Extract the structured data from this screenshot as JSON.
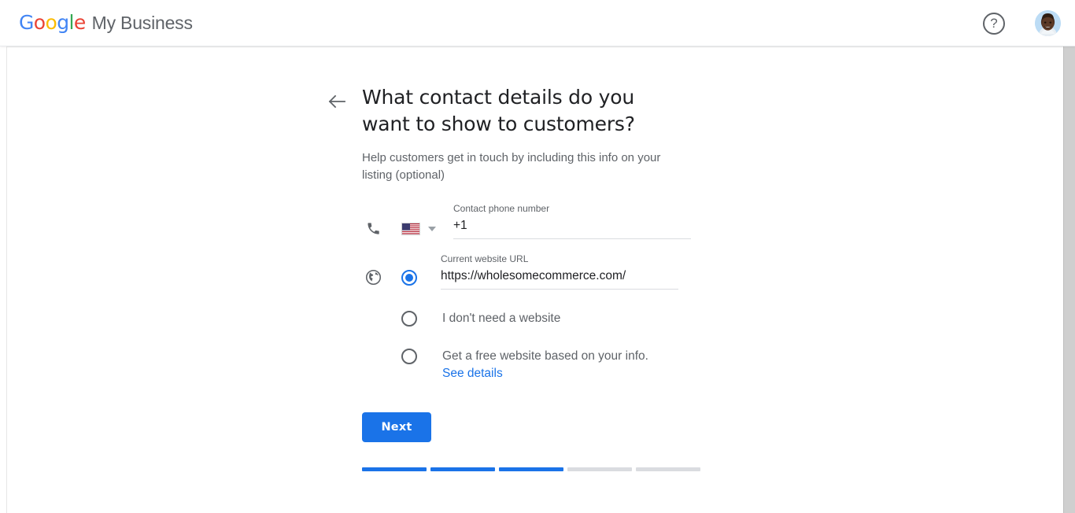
{
  "header": {
    "logo_google": "Google",
    "logo_suffix": "My Business",
    "help_icon_label": "?",
    "help_icon_name": "help-circle-icon",
    "avatar_name": "user-avatar"
  },
  "main": {
    "back_arrow_name": "back-arrow-icon",
    "title": "What contact details do you want to show to customers?",
    "subtitle": "Help customers get in touch by including this info on your listing (optional)",
    "phone": {
      "icon_name": "phone-icon",
      "flag_name": "us-flag-icon",
      "flag_country": "US",
      "caret_name": "chevron-down-icon",
      "label": "Contact phone number",
      "value": "+1",
      "placeholder": ""
    },
    "website": {
      "icon_name": "globe-icon",
      "label": "Current website URL",
      "value": "https://wholesomecommerce.com/",
      "placeholder": ""
    },
    "options": [
      {
        "id": "current-url",
        "text": "",
        "selected": true
      },
      {
        "id": "no-website",
        "text": "I don't need a website",
        "selected": false
      },
      {
        "id": "free-website",
        "text": "Get a free website based on your info.",
        "link": "See details",
        "selected": false
      }
    ],
    "next_button": "Next",
    "progress": {
      "total_steps": 5,
      "completed_steps": 3,
      "segments": [
        true,
        true,
        true,
        false,
        false
      ]
    }
  },
  "colors": {
    "accent_blue": "#1a73e8",
    "google_blue": "#4285F4",
    "google_red": "#EA4335",
    "google_yellow": "#FBBC05",
    "google_green": "#34A853",
    "text_primary": "#202124",
    "text_secondary": "#5f6368",
    "divider": "#dadce0"
  }
}
